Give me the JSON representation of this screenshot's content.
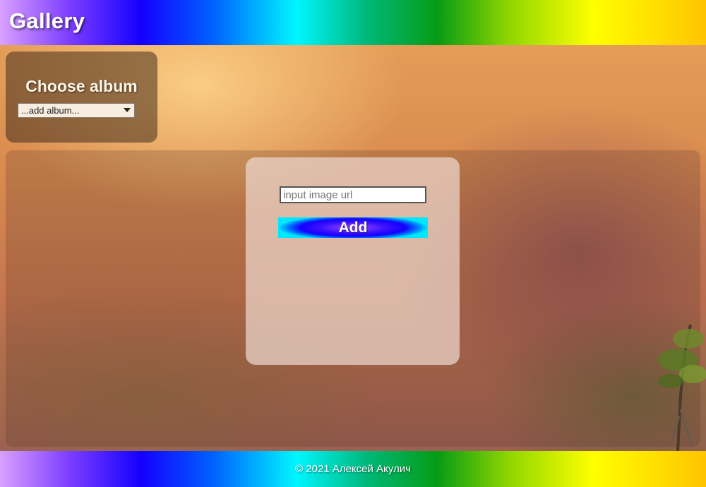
{
  "header": {
    "title": "Gallery"
  },
  "album": {
    "heading": "Choose album",
    "selected_option": "...add album..."
  },
  "add_form": {
    "url_placeholder": "input image url",
    "url_value": "",
    "add_label": "Add"
  },
  "footer": {
    "copyright": "© 2021 Алексей Акулич"
  },
  "icons": {
    "select_caret": "chevron-down-icon"
  },
  "colors": {
    "button_center": "#9b4dff",
    "button_edge": "#00e8ff"
  }
}
